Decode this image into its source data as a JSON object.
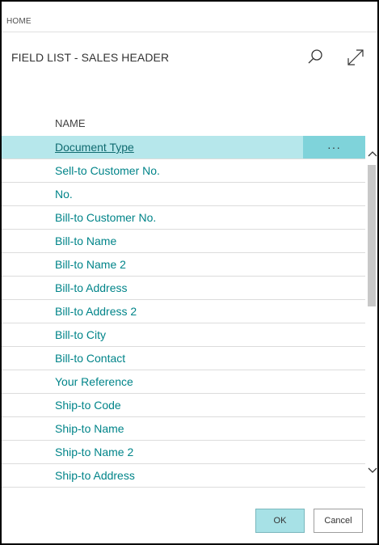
{
  "breadcrumb": {
    "label": "HOME"
  },
  "header": {
    "title": "FIELD LIST - SALES HEADER",
    "search_icon": "search-icon",
    "expand_icon": "expand-icon"
  },
  "list": {
    "column_header": "NAME",
    "selected_index": 0,
    "more_label": "···",
    "items": [
      "Document Type",
      "Sell-to Customer No.",
      "No.",
      "Bill-to Customer No.",
      "Bill-to Name",
      "Bill-to Name 2",
      "Bill-to Address",
      "Bill-to Address 2",
      "Bill-to City",
      "Bill-to Contact",
      "Your Reference",
      "Ship-to Code",
      "Ship-to Name",
      "Ship-to Name 2",
      "Ship-to Address"
    ]
  },
  "footer": {
    "ok_label": "OK",
    "cancel_label": "Cancel"
  },
  "colors": {
    "accent": "#008489",
    "selected_row": "#b6e7eb",
    "more_button": "#7fd3da",
    "ok_button": "#a7e1e6"
  }
}
